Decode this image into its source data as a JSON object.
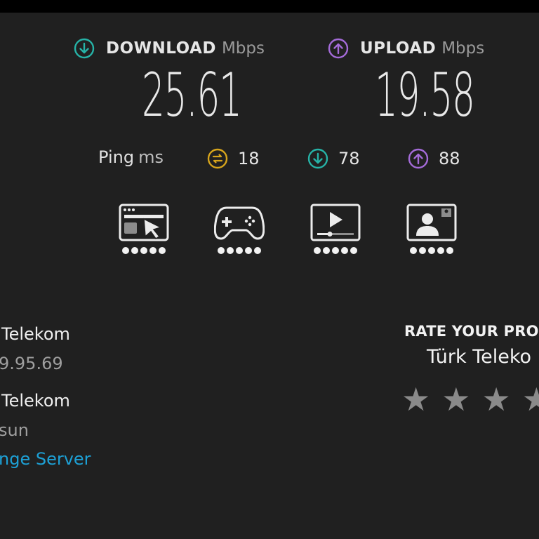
{
  "download": {
    "label": "DOWNLOAD",
    "unit": "Mbps",
    "value": "25.61",
    "icon": "arrow-down-circle-icon",
    "color": "#26b3a7"
  },
  "upload": {
    "label": "UPLOAD",
    "unit": "Mbps",
    "value": "19.58",
    "icon": "arrow-up-circle-icon",
    "color": "#a46bd8"
  },
  "ping": {
    "label": "Ping",
    "unit": "ms",
    "idle": "18",
    "download": "78",
    "upload": "88",
    "idle_color": "#d7a51c"
  },
  "activities": [
    {
      "name": "web-browsing",
      "icon": "browser-cursor-icon",
      "rating": 5
    },
    {
      "name": "gaming",
      "icon": "gamepad-icon",
      "rating": 5
    },
    {
      "name": "video-streaming",
      "icon": "video-play-icon",
      "rating": 5
    },
    {
      "name": "video-chat",
      "icon": "user-video-icon",
      "rating": 5
    }
  ],
  "connection": {
    "isp_name": "Telekom",
    "ip": "9.95.69",
    "server_name": "Telekom",
    "server_location": "sun",
    "change_server": "nge Server"
  },
  "rating": {
    "title": "RATE YOUR PRO",
    "isp": "Türk Teleko",
    "stars": 4,
    "star_color": "#8a8a8a"
  }
}
